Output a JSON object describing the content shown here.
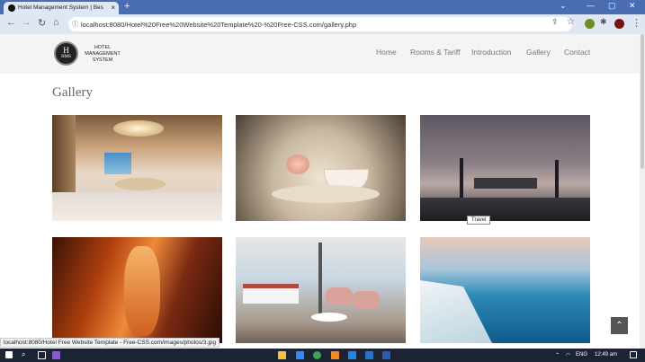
{
  "browser": {
    "tab_title": "Hotel Management System | Bes",
    "tab_close": "×",
    "new_tab": "+",
    "url": "localhost:8080/Hotel%20Free%20Website%20Template%20-%20Free-CSS.com/gallery.php",
    "status_url": "localhost:8080/Hotel Free Website Template - Free-CSS.com/images/photos/3.jpg",
    "back": "←",
    "forward": "→",
    "reload": "↻",
    "home": "⌂",
    "min": "—",
    "max": "▢",
    "close": "✕",
    "chevron": "⌄",
    "share": "⇪",
    "star": "☆",
    "puzzle": "✱",
    "menu": "⋮"
  },
  "site": {
    "logo_letter": "H",
    "logo_small": "HMS",
    "logo_text_1": "HOTEL",
    "logo_text_2": "MANAGEMENT",
    "logo_text_3": "SYSTEM",
    "nav": [
      "Home",
      "Rooms & Tariff",
      "Introduction",
      "Gallery",
      "Contact"
    ],
    "page_heading": "Gallery",
    "tooltip": "Travel",
    "to_top": "⌃"
  },
  "taskbar": {
    "lang": "ENG",
    "time": "12:49 am",
    "up_arrow": "⌃"
  },
  "colors": {
    "tabbar": "#4a6cb0",
    "header_bg": "#f4f4f4",
    "taskbar": "#1c2434"
  }
}
